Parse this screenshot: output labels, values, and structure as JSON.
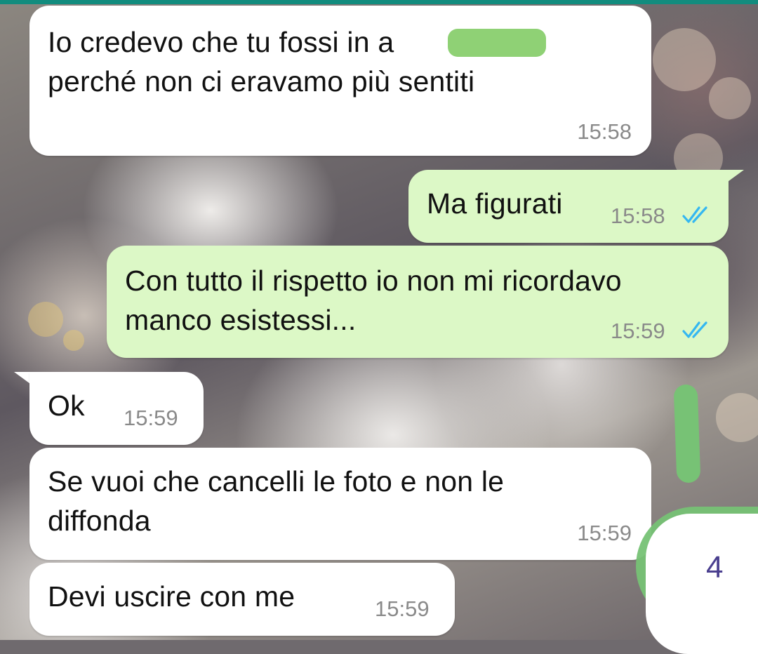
{
  "colors": {
    "incoming_bubble": "#ffffff",
    "outgoing_bubble": "#dcf8c6",
    "read_ticks": "#34b7f1",
    "timestamp": "#8a8a8a",
    "marker_green": "#77c275"
  },
  "messages": [
    {
      "id": "m1",
      "direction": "incoming",
      "text": "Io credevo che tu fossi in               a\nperché non ci eravamo più sentiti",
      "time": "15:58"
    },
    {
      "id": "m2",
      "direction": "outgoing",
      "text": "Ma figurati",
      "time": "15:58",
      "status": "read-double-check-icon"
    },
    {
      "id": "m3",
      "direction": "outgoing",
      "text": "Con tutto il rispetto io non mi ricordavo\nmanco esistessi...",
      "time": "15:59",
      "status": "read-double-check-icon"
    },
    {
      "id": "m4",
      "direction": "incoming",
      "text": "Ok",
      "time": "15:59"
    },
    {
      "id": "m5",
      "direction": "incoming",
      "text": "Se vuoi che cancelli le foto e non le\ndiffonda",
      "time": "15:59"
    },
    {
      "id": "m6",
      "direction": "incoming",
      "text": "Devi uscire con me",
      "time": "15:59"
    }
  ],
  "annotation": {
    "label": "4"
  }
}
